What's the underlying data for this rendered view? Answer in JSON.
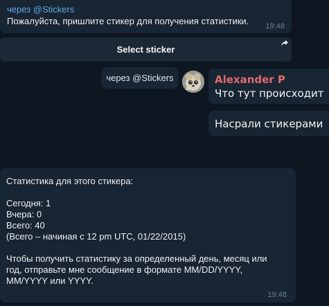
{
  "top_message": {
    "via": "через @Stickers",
    "text": "Пожалуйста, пришлите стикер для получения статистики.",
    "time": "19:48"
  },
  "inline_button": {
    "label": "Select sticker",
    "icon": "share-arrow-icon"
  },
  "via_chip": {
    "text": "через @Stickers"
  },
  "sender": {
    "name": "Alexander P",
    "name_color": "#e06a6a",
    "avatar_icon": "user-avatar"
  },
  "right_messages": [
    {
      "text": "Что тут происходит"
    },
    {
      "text": "Насрали стикерами"
    }
  ],
  "stats_message": {
    "text": "Статистика для этого стикера:\n\nСегодня: 1\nВчера: 0\nВсего: 40\n(Всего – начиная с 12 pm UTC, 01/22/2015)\n\nЧтобы получить статистику за определенный день, месяц или год, отправьте мне сообщение в формате MM/DD/YYYY, MM/YYYY или YYYY.",
    "time": "19:48"
  },
  "colors": {
    "background": "#0e1621",
    "bubble": "#182533",
    "link": "#61a8e8",
    "time": "#6d7f8f"
  }
}
